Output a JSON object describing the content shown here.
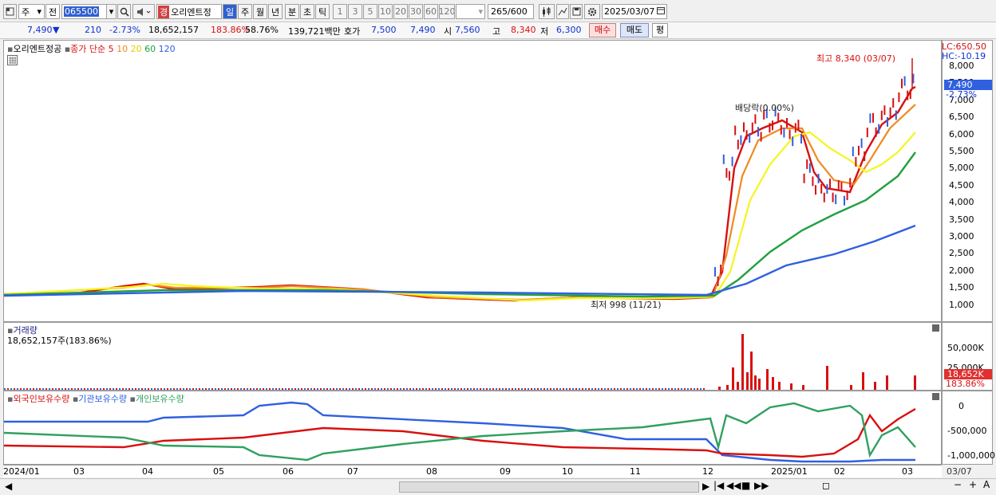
{
  "toolbar": {
    "market": "주",
    "scope": "전",
    "code": "065500",
    "name": "오리엔트정",
    "warn": "경",
    "periods": [
      "일",
      "주",
      "월",
      "년",
      "분",
      "초",
      "틱"
    ],
    "nums": [
      "1",
      "3",
      "5",
      "10",
      "20",
      "30",
      "60",
      "120"
    ],
    "count": "265",
    "count_total": "/600",
    "date": "2025/03/07"
  },
  "info": {
    "price": "7,490",
    "arrow": "▼",
    "change": "210",
    "rate": "-2.73%",
    "volume": "18,652,157",
    "vol_rate": "183.86%",
    "turnover": "58.76%",
    "amount": "139,721백만",
    "quote_label": "호가",
    "ask": "7,500",
    "bid": "7,490",
    "open_label": "시",
    "open": "7,560",
    "high_label": "고",
    "high": "8,340",
    "low_label": "저",
    "low": "6,300",
    "buy": "매수",
    "sell": "매도",
    "eval": "평"
  },
  "price_panel": {
    "title": "오리엔트정공",
    "ma_label": "종가 단순",
    "ma_periods": [
      "5",
      "10",
      "20",
      "60",
      "120"
    ],
    "ma_colors": [
      "#d81010",
      "#f08a20",
      "#f5f520",
      "#20a040",
      "#3060e0"
    ],
    "lc": "LC:650.50",
    "hc": "HC:-10.19",
    "ticks": [
      "8,000",
      "7,500",
      "7,000",
      "6,500",
      "6,000",
      "5,500",
      "5,000",
      "4,500",
      "4,000",
      "3,500",
      "3,000",
      "2,500",
      "2,000",
      "1,500",
      "1,000"
    ],
    "cur_price": "7,490",
    "cur_rate": "-2.73%",
    "high_note": "최고 8,340 (03/07)",
    "low_note": "최저 998 (11/21)",
    "dividend_note": "배당락(0.00%)"
  },
  "volume_panel": {
    "title": "거래량",
    "value": "18,652,157주(183.86%)",
    "ticks": [
      "50,000K",
      "25,000K"
    ],
    "cur": "18,652K",
    "cur_rate": "183.86%"
  },
  "flow_panel": {
    "series": [
      "외국인보유수량",
      "기관보유수량",
      "개인보유수량"
    ],
    "series_colors": [
      "#d81010",
      "#3060e0",
      "#30a060"
    ],
    "ticks": [
      "0",
      "-500,000",
      "-1,000,000"
    ]
  },
  "xaxis": {
    "labels": [
      "2024/01",
      "03",
      "04",
      "05",
      "06",
      "07",
      "08",
      "09",
      "10",
      "11",
      "12",
      "2025/01",
      "02",
      "03"
    ],
    "right_label": "03/07"
  }
}
